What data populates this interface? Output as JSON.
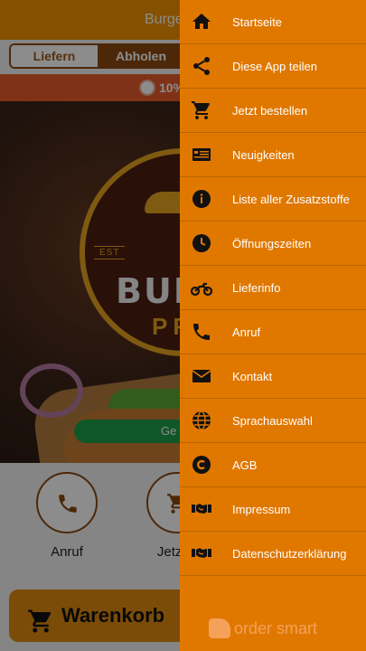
{
  "header": {
    "title": "Burge"
  },
  "order_mode": {
    "deliver_label": "Liefern",
    "pickup_label": "Abholen",
    "selected": "Abholen"
  },
  "promo": {
    "text": "10%"
  },
  "hero": {
    "logo_main": "BUR",
    "logo_sub": "PR",
    "logo_est": "EST",
    "button_label": "Ge"
  },
  "quick_actions": {
    "call_label": "Anruf",
    "order_label": "Jetzt b"
  },
  "cart": {
    "label": "Warenkorb"
  },
  "drawer": {
    "items": [
      {
        "label": "Startseite",
        "icon": "home-icon"
      },
      {
        "label": "Diese App teilen",
        "icon": "share-icon"
      },
      {
        "label": "Jetzt bestellen",
        "icon": "cart-icon"
      },
      {
        "label": "Neuigkeiten",
        "icon": "news-icon"
      },
      {
        "label": "Liste aller Zusatzstoffe",
        "icon": "info-icon"
      },
      {
        "label": "Öffnungszeiten",
        "icon": "clock-icon"
      },
      {
        "label": "Lieferinfo",
        "icon": "motorcycle-icon"
      },
      {
        "label": "Anruf",
        "icon": "phone-icon"
      },
      {
        "label": "Kontakt",
        "icon": "mail-icon"
      },
      {
        "label": "Sprachauswahl",
        "icon": "globe-icon"
      },
      {
        "label": "AGB",
        "icon": "copyright-icon"
      },
      {
        "label": "Impressum",
        "icon": "handshake-icon"
      },
      {
        "label": "Datenschutzerklärung",
        "icon": "handshake-icon"
      }
    ],
    "brand": "order smart"
  },
  "colors": {
    "header": "#f29400",
    "drawer": "#e07800",
    "accent_dark": "#8a4a12",
    "promo": "#e85b2a"
  }
}
